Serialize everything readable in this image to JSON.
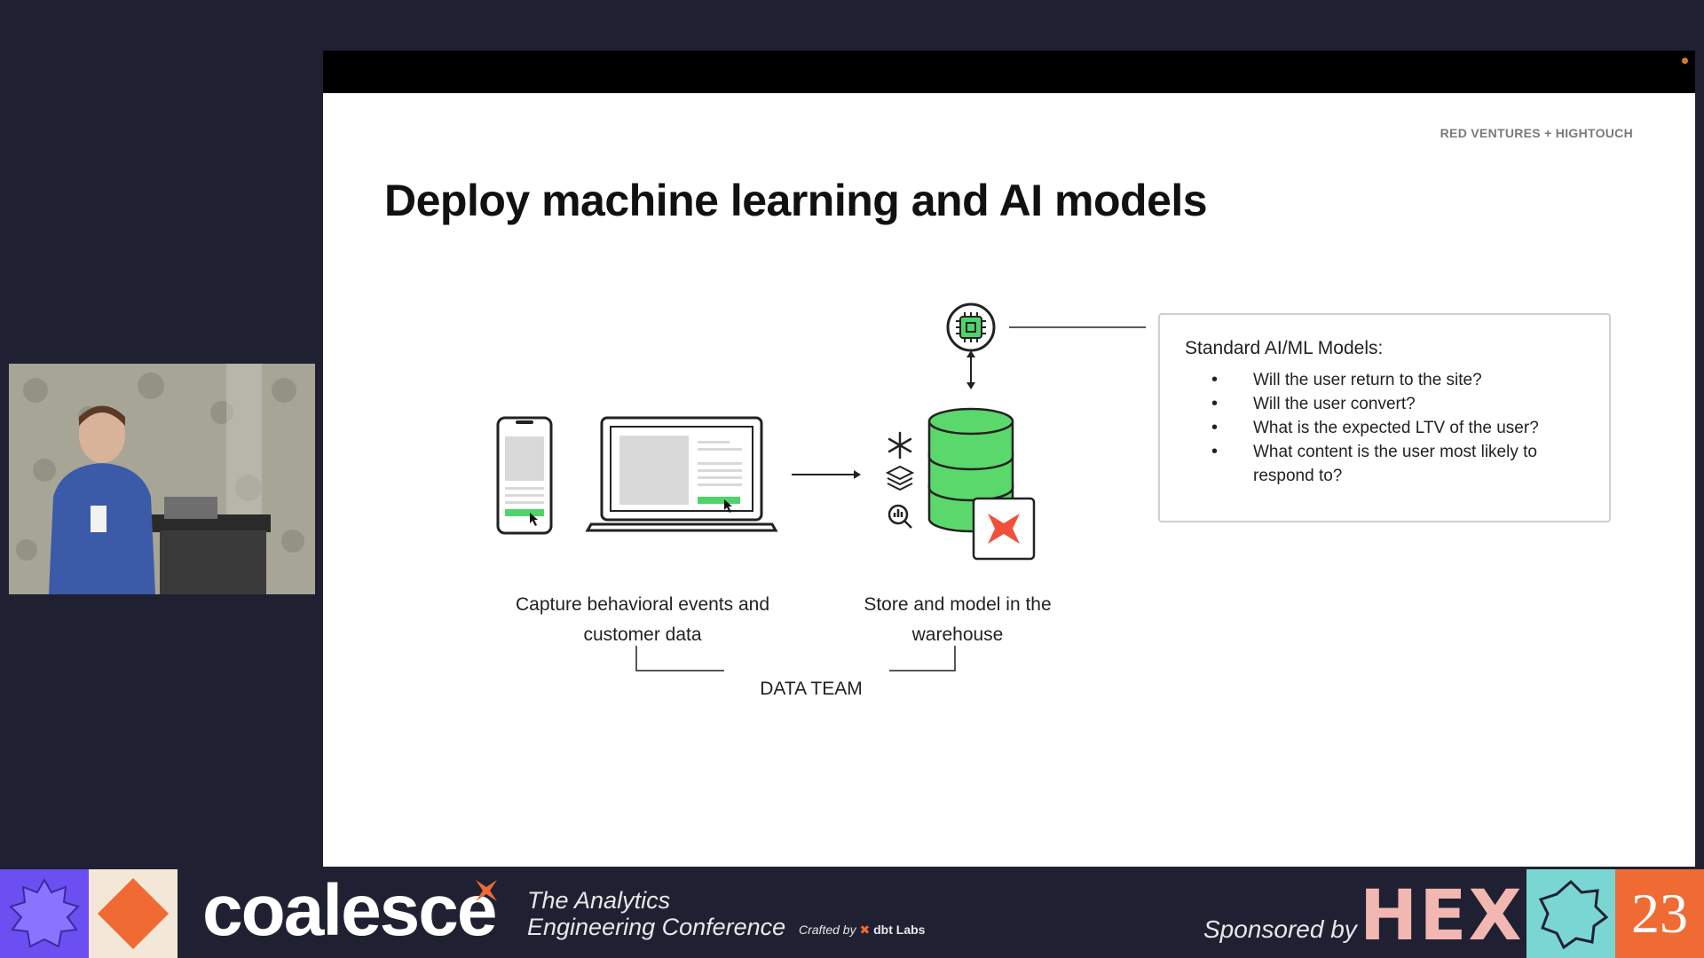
{
  "slide": {
    "brand_tag": "RED VENTURES + HIGHTOUCH",
    "title": "Deploy machine learning and AI models",
    "captions": {
      "capture": "Capture behavioral events and customer data",
      "store": "Store and model in the warehouse",
      "team": "DATA TEAM"
    },
    "models": {
      "title": "Standard AI/ML Models:",
      "items": [
        "Will the user return to the site?",
        "Will the user convert?",
        "What is the expected LTV of the user?",
        "What content is the user most likely to respond to?"
      ]
    },
    "colors": {
      "accent_green": "#4ed46a",
      "warehouse_green": "#5bd86b",
      "dbt_orange": "#f0503a"
    }
  },
  "banner": {
    "logo": "coalesce",
    "tagline_line1": "The Analytics",
    "tagline_line2": "Engineering Conference",
    "crafted_prefix": "Crafted by",
    "crafted_brand": "dbt Labs",
    "sponsored": "Sponsored by",
    "sponsor": "HEX",
    "year": "23",
    "colors": {
      "tile_purple": "#6b4ff0",
      "tile_orange": "#f06a33",
      "tile_teal": "#7ad6d2",
      "hex_pink": "#f2b7b0"
    }
  }
}
